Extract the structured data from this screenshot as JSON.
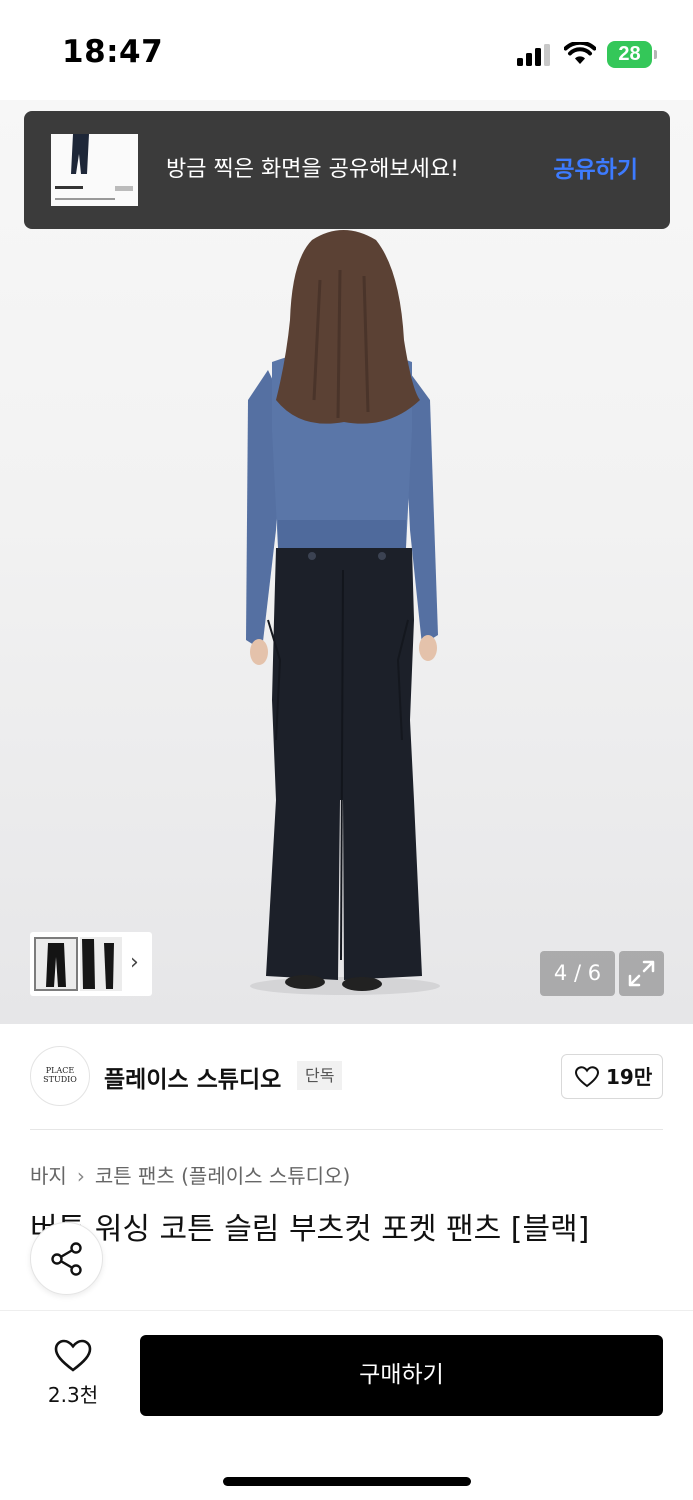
{
  "status_bar": {
    "time": "18:47",
    "battery": "28"
  },
  "toast": {
    "message": "방금 찍은 화면을 공유해보세요!",
    "action_label": "공유하기"
  },
  "gallery": {
    "counter": "4 / 6",
    "current_index": 4,
    "total": 6
  },
  "brand": {
    "name": "플레이스 스튜디오",
    "badge": "단독",
    "logo_lines": [
      "PLACE",
      "STUDIO"
    ],
    "likes": "19만"
  },
  "breadcrumb": {
    "category": "바지",
    "subcategory": "코튼 팬츠 (플레이스 스튜디오)"
  },
  "product": {
    "title": "버튼 워싱 코튼 슬림 부츠컷 포켓 팬츠 [블랙]"
  },
  "bottom_bar": {
    "wish_count": "2.3천",
    "buy_label": "구매하기"
  },
  "colors": {
    "accent": "#3d7bff",
    "battery": "#34c759",
    "toast_bg": "#3b3b3b",
    "buy_bg": "#000000"
  },
  "icons": [
    "signal-icon",
    "wifi-icon",
    "battery-icon",
    "chevron-right-icon",
    "expand-icon",
    "heart-icon",
    "share-icon"
  ]
}
